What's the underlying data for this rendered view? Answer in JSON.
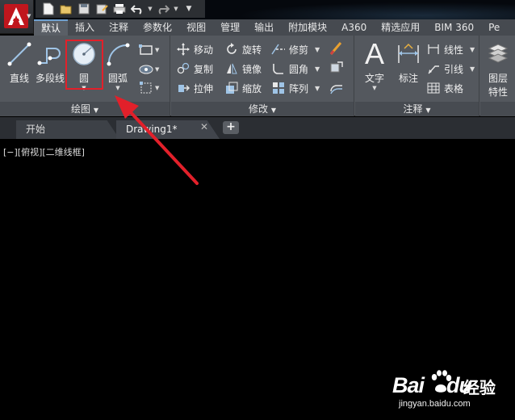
{
  "ribbon_tabs": [
    "默认",
    "插入",
    "注释",
    "参数化",
    "视图",
    "管理",
    "输出",
    "附加模块",
    "A360",
    "精选应用",
    "BIM 360",
    "Pe"
  ],
  "draw_panel": {
    "title": "绘图",
    "line": "直线",
    "polyline": "多段线",
    "circle": "圆",
    "arc": "圆弧"
  },
  "modify_panel": {
    "title": "修改",
    "move": "移动",
    "rotate": "旋转",
    "trim": "修剪",
    "copy": "复制",
    "mirror": "镜像",
    "fillet": "圆角",
    "stretch": "拉伸",
    "scale": "缩放",
    "array": "阵列"
  },
  "annotation_panel": {
    "title": "注释",
    "text": "文字",
    "dimension": "标注",
    "linear": "线性",
    "leader": "引线",
    "table": "表格"
  },
  "layers_panel": {
    "properties_line1": "图层",
    "properties_line2": "特性"
  },
  "doc_tabs": {
    "start": "开始",
    "drawing": "Drawing1*",
    "new_tab": "+"
  },
  "viewport_label": "[−][俯视][二维线框]",
  "watermark": {
    "brand": "Bai",
    "brand_tail": "du",
    "jingyan": "经验",
    "url": "jingyan.baidu.com"
  },
  "colors": {
    "highlight": "#e2202a",
    "arrow": "#e2202a",
    "accent_tab": "#6fa0d0"
  }
}
